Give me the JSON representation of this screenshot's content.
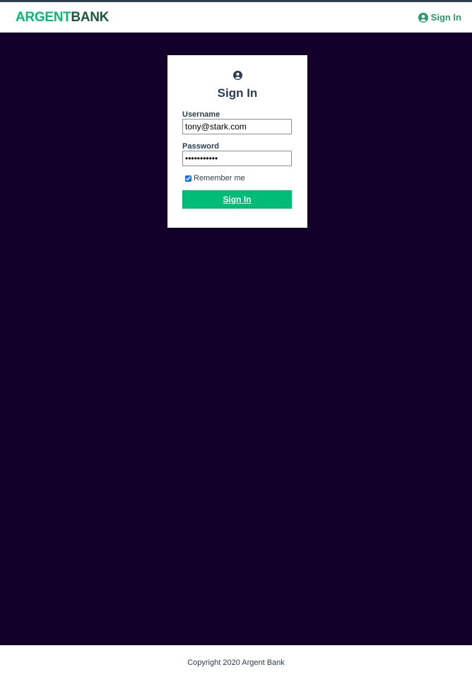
{
  "nav": {
    "logo_part1": "ARGENT",
    "logo_part2": "BANK",
    "signin_label": "Sign In",
    "signin_icon": "user-circle-icon"
  },
  "form": {
    "icon": "user-circle-icon",
    "title": "Sign In",
    "username_label": "Username",
    "username_value": "tony@stark.com",
    "password_label": "Password",
    "password_value": "password123",
    "remember_label": "Remember me",
    "remember_checked": true,
    "submit_label": "Sign In"
  },
  "footer": {
    "text": "Copyright 2020 Argent Bank"
  },
  "colors": {
    "accent": "#00bc77",
    "background": "#12002b",
    "text": "#2c3e50"
  }
}
